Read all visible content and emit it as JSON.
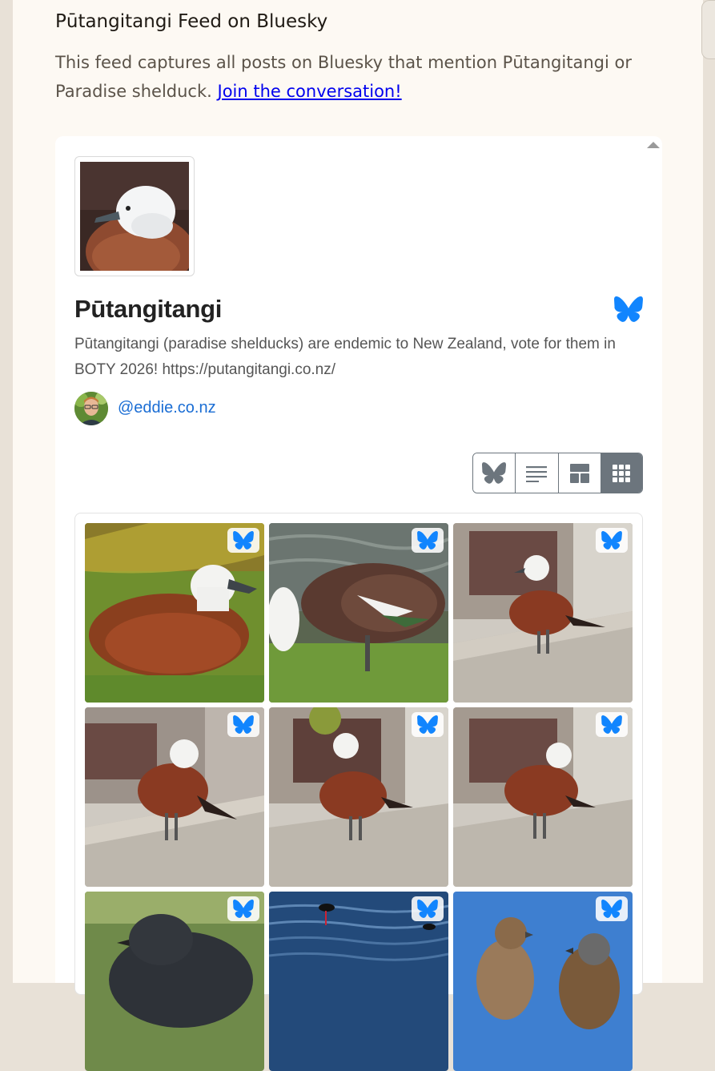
{
  "page": {
    "feed_title": "Pūtangitangi Feed on Bluesky",
    "intro_text": "This feed captures all posts on Bluesky that mention Pūtangitangi or Paradise shelduck.",
    "intro_link": "Join the conversation!"
  },
  "profile": {
    "name": "Pūtangitangi",
    "description": "Pūtangitangi (paradise shelducks) are endemic to New Zealand, vote for them in BOTY 2026! https://putangitangi.co.nz/",
    "owner_handle": "@eddie.co.nz",
    "avatar_icon": "paradise-shelduck-photo",
    "service_icon": "bluesky-butterfly-icon"
  },
  "view_toggle": {
    "options": [
      "bluesky",
      "list",
      "masonry",
      "grid"
    ],
    "selected": "grid"
  },
  "gallery": {
    "badge_icon": "bluesky-butterfly-icon",
    "tiles": [
      {
        "subject": "white-headed duck resting on grass"
      },
      {
        "subject": "duck feeding on grass"
      },
      {
        "subject": "duck standing on step"
      },
      {
        "subject": "duck preening on step"
      },
      {
        "subject": "duck standing on step"
      },
      {
        "subject": "duck preening on step"
      },
      {
        "subject": "dark duck on grass"
      },
      {
        "subject": "stilts in water"
      },
      {
        "subject": "sparrows on sky"
      }
    ]
  },
  "colors": {
    "page_bg": "#fdf9f3",
    "link": "#0000ee",
    "handle": "#1a6dd4",
    "bluesky": "#1185fe",
    "toggle_active": "#6c757d"
  }
}
